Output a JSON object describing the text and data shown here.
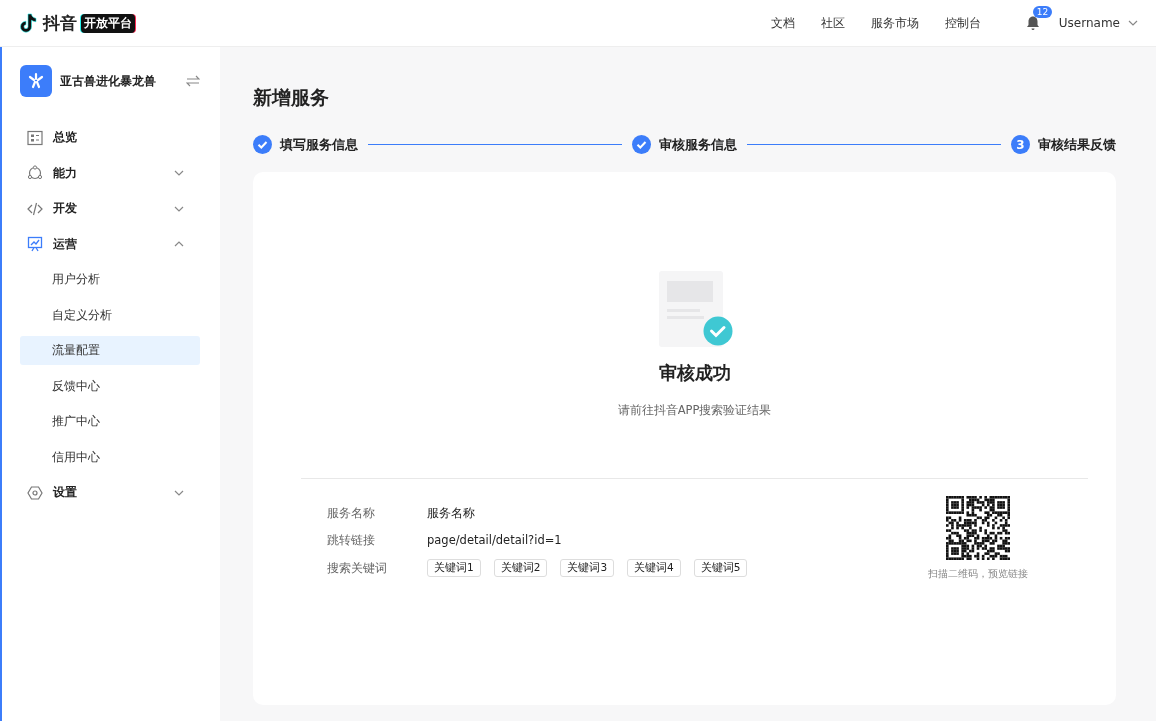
{
  "header": {
    "logo_text": "抖音",
    "logo_badge": "开放平台",
    "nav": [
      "文档",
      "社区",
      "服务市场",
      "控制台"
    ],
    "notification_count": "12",
    "username": "Username"
  },
  "sidebar": {
    "app_name": "亚古兽进化暴龙兽",
    "items": [
      {
        "label": "总览",
        "kind": "link",
        "selected": false
      },
      {
        "label": "能力",
        "kind": "group",
        "expanded": false
      },
      {
        "label": "开发",
        "kind": "group",
        "expanded": false
      },
      {
        "label": "运营",
        "kind": "group",
        "expanded": true,
        "children": [
          {
            "label": "用户分析",
            "selected": false
          },
          {
            "label": "自定义分析",
            "selected": false
          },
          {
            "label": "流量配置",
            "selected": true
          },
          {
            "label": "反馈中心",
            "selected": false
          },
          {
            "label": "推广中心",
            "selected": false
          },
          {
            "label": "信用中心",
            "selected": false
          }
        ]
      },
      {
        "label": "设置",
        "kind": "group",
        "expanded": false
      }
    ]
  },
  "page": {
    "title": "新增服务",
    "steps": [
      {
        "label": "填写服务信息",
        "done": true
      },
      {
        "label": "审核服务信息",
        "done": true
      },
      {
        "label": "审核结果反馈",
        "done": false,
        "number": "3"
      }
    ],
    "result": {
      "title": "审核成功",
      "subtitle": "请前往抖音APP搜索验证结果"
    },
    "details": [
      {
        "label": "服务名称",
        "value": "服务名称"
      },
      {
        "label": "跳转链接",
        "value": "page/detail/detail?id=1"
      },
      {
        "label": "搜索关键词",
        "tags": [
          "关键词1",
          "关键词2",
          "关键词3",
          "关键词4",
          "关键词5"
        ]
      }
    ],
    "qr_caption": "扫描二维码，预览链接"
  }
}
